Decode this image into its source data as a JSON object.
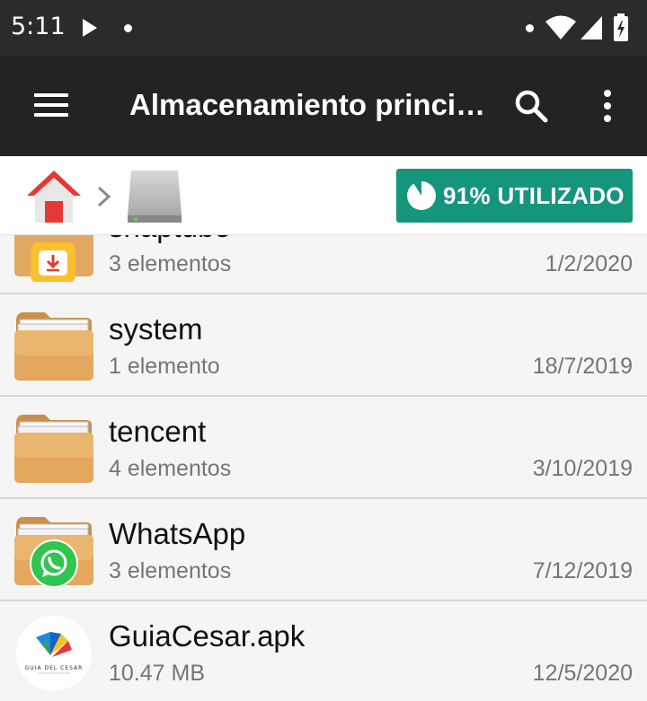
{
  "status_bar": {
    "time": "5:11",
    "icons": [
      "play-icon",
      "notification-dot-icon",
      "dot-icon",
      "wifi-icon",
      "signal-icon",
      "battery-icon"
    ]
  },
  "toolbar": {
    "title": "Almacenamiento principal",
    "menu_icon": "hamburger-menu-icon",
    "search_icon": "search-icon",
    "more_icon": "more-vert-icon"
  },
  "path": {
    "items": [
      "home-icon",
      "storage-drive-icon"
    ],
    "usage_label": "91% UTILIZADO",
    "usage_percent": 91
  },
  "files": [
    {
      "name": "snaptube",
      "detail": "3 elementos",
      "date": "1/2/2020",
      "icon": "snaptube-folder-icon"
    },
    {
      "name": "system",
      "detail": "1 elemento",
      "date": "18/7/2019",
      "icon": "folder-icon"
    },
    {
      "name": "tencent",
      "detail": "4 elementos",
      "date": "3/10/2019",
      "icon": "folder-icon"
    },
    {
      "name": "WhatsApp",
      "detail": "3 elementos",
      "date": "7/12/2019",
      "icon": "whatsapp-folder-icon"
    },
    {
      "name": "GuiaCesar.apk",
      "detail": "10.47 MB",
      "date": "12/5/2020",
      "icon": "guia-del-cesar-app-icon",
      "icon_text": "GUIA DEL CESAR"
    }
  ],
  "colors": {
    "toolbar": "#232323",
    "statusbar": "#2b2b2b",
    "accent": "#15957c",
    "folder": "#e0a860"
  }
}
